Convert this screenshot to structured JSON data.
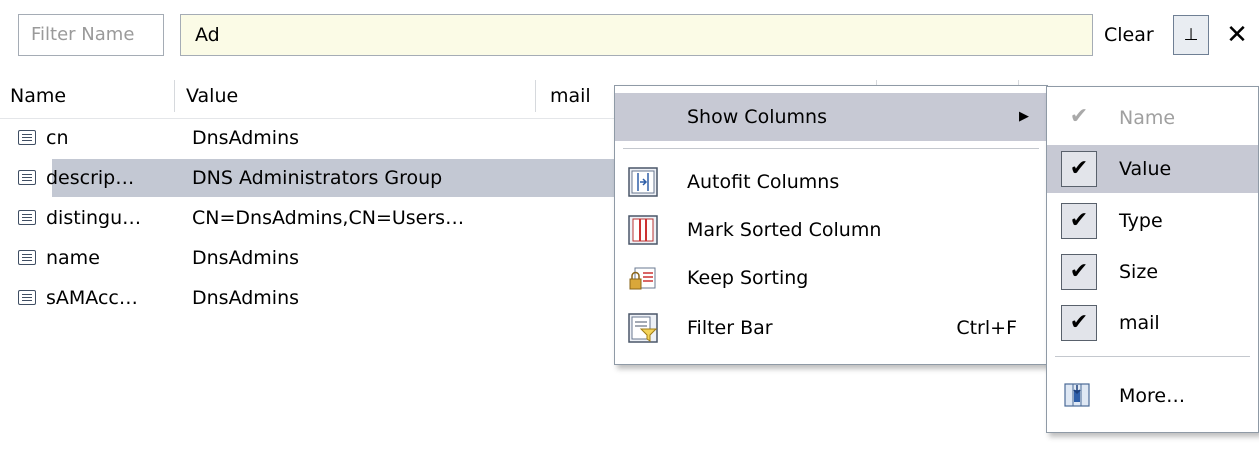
{
  "filter_bar": {
    "name_placeholder": "Filter Name",
    "query_value": "Ad",
    "clear_label": "Clear",
    "pin_glyph": "⊥",
    "close_glyph": "✕"
  },
  "columns": [
    "Name",
    "Value",
    "mail"
  ],
  "rows": [
    {
      "name": "cn",
      "value": "DnsAdmins"
    },
    {
      "name": "descrip…",
      "value": "DNS Administrators Group"
    },
    {
      "name": "distingu…",
      "value": "CN=DnsAdmins,CN=Users…"
    },
    {
      "name": "name",
      "value": "DnsAdmins"
    },
    {
      "name": "sAMAcc…",
      "value": "DnsAdmins"
    }
  ],
  "selected_row_index": 1,
  "context_menu": {
    "items": [
      {
        "label": "Show Columns",
        "submenu_arrow": "▶",
        "icon": ""
      },
      {
        "label": "Autofit Columns",
        "icon": "autofit-icon"
      },
      {
        "label": "Mark Sorted Column",
        "icon": "mark-sorted-icon"
      },
      {
        "label": "Keep Sorting",
        "icon": "keep-sorting-icon"
      },
      {
        "label": "Filter Bar",
        "shortcut": "Ctrl+F",
        "icon": "filter-bar-icon"
      }
    ]
  },
  "columns_submenu": {
    "items": [
      {
        "label": "Name",
        "checked": true,
        "disabled": true
      },
      {
        "label": "Value",
        "checked": true,
        "highlighted": true
      },
      {
        "label": "Type",
        "checked": true
      },
      {
        "label": "Size",
        "checked": true
      },
      {
        "label": "mail",
        "checked": true
      }
    ],
    "more_label": "More…",
    "check_glyph": "✔"
  },
  "colors": {
    "selection": "#c3c8d3",
    "menu_highlight": "#c7c9d4",
    "filter_input_bg": "#fbfbe6"
  }
}
